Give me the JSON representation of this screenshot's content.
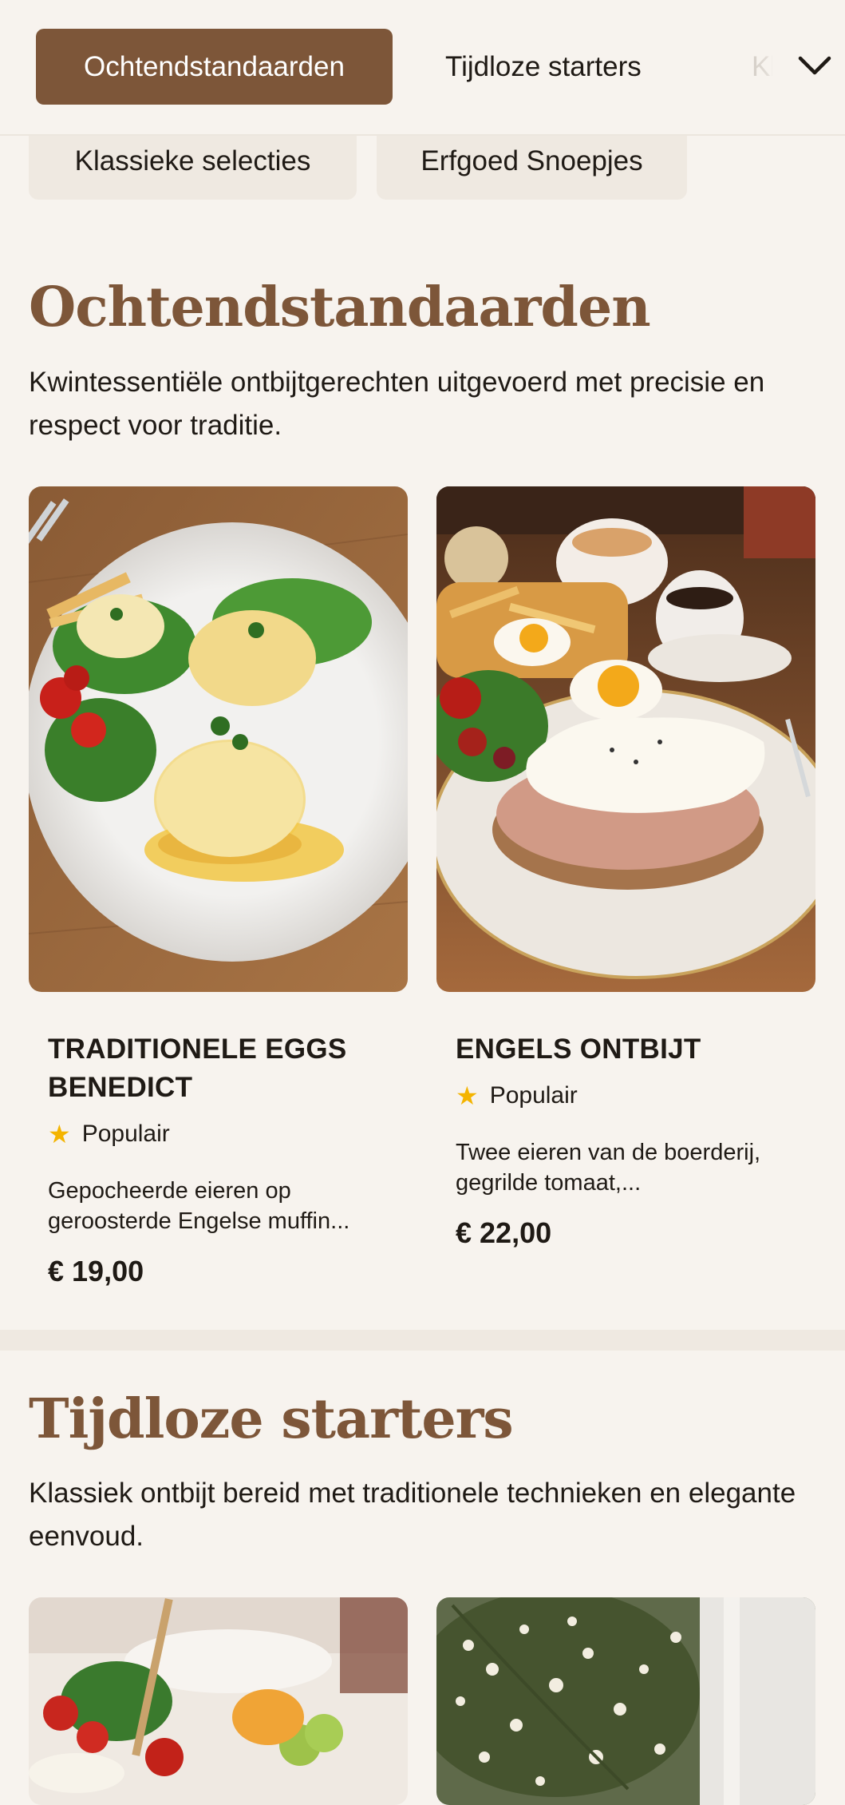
{
  "nav": {
    "tabs": [
      {
        "label": "Ochtendstandaarden",
        "active": true
      },
      {
        "label": "Tijdloze starters",
        "active": false
      },
      {
        "label": "Klassieke selecties",
        "active": false
      }
    ],
    "tab3_partial": "Kl",
    "chips": [
      "Klassieke selecties",
      "Erfgoed Snoepjes"
    ],
    "dropdown_icon": "chevron-down-icon"
  },
  "sections": [
    {
      "title": "Ochtendstandaarden",
      "description": "Kwintessentiële ontbijtgerechten uitgevoerd met precisie en respect voor traditie.",
      "items": [
        {
          "name": "TRADITIONELE EGGS BENEDICT",
          "badge": "Populair",
          "description": "Gepocheerde eieren op geroosterde Engelse muffin...",
          "price": "€ 19,00"
        },
        {
          "name": "ENGELS ONTBIJT",
          "badge": "Populair",
          "description": "Twee eieren van de boerderij, gegrilde tomaat,...",
          "price": "€ 22,00"
        }
      ]
    },
    {
      "title": "Tijdloze starters",
      "description": "Klassiek ontbijt bereid met traditionele technieken en elegante eenvoud."
    }
  ],
  "colors": {
    "accent": "#7d5639",
    "background": "#f7f3ee",
    "chip_bg": "#efe9e1",
    "star": "#f4b400"
  }
}
